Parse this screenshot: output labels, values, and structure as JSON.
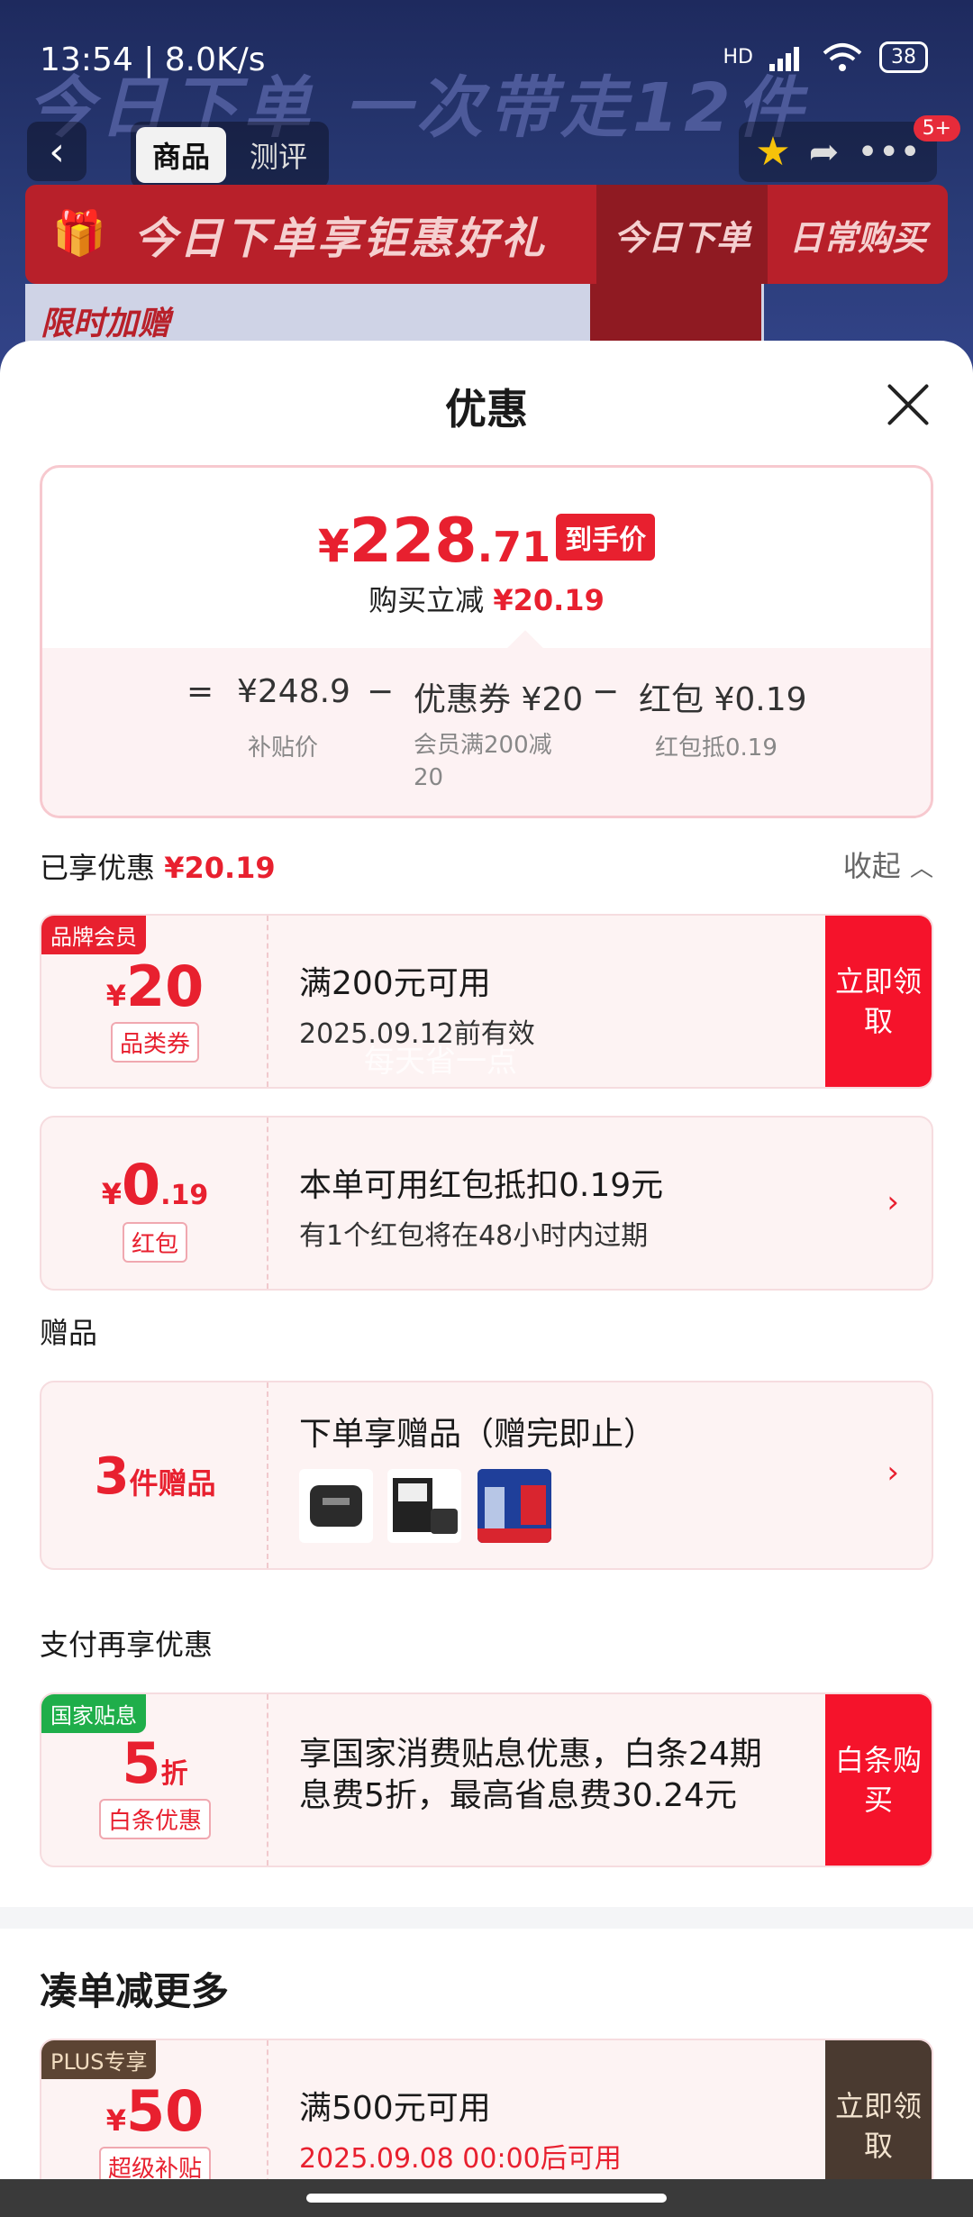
{
  "status": {
    "time": "13:54 | 8.0K/s",
    "battery": "38",
    "network": "HD"
  },
  "background": {
    "banner": "今日下单 一次带走12件",
    "tabs": [
      "商品",
      "测评"
    ],
    "badge": "5+",
    "promo_title": "今日下单享钜惠好礼",
    "promo_tab_today": "今日下单",
    "promo_tab_daily": "日常购买",
    "promo_sub": "限时加赠"
  },
  "sheet": {
    "title": "优惠",
    "price": {
      "currency": "¥",
      "integer": "228",
      "decimal": ".71",
      "tag": "到手价",
      "reduce_label": "购买立减",
      "reduce_value": "¥20.19",
      "eq": "=",
      "base": "¥248.9",
      "minus1": "−",
      "coupon_part": "优惠券 ¥20",
      "minus2": "−",
      "redpack_part": "红包 ¥0.19",
      "base_sub": "补贴价",
      "coupon_sub": "会员满200减20",
      "redpack_sub": "红包抵0.19"
    },
    "enjoyed": {
      "label": "已享优惠",
      "value": "¥20.19",
      "collapse": "收起"
    },
    "coupon1": {
      "badge": "品牌会员",
      "currency": "¥",
      "amount": "20",
      "type": "品类券",
      "line1": "满200元可用",
      "line2": "2025.09.12前有效",
      "action": "立即领取"
    },
    "watermark": "每天省一点",
    "coupon2": {
      "currency": "¥",
      "amount": "0",
      "decimal": ".19",
      "type": "红包",
      "line1": "本单可用红包抵扣0.19元",
      "line2": "有1个红包将在48小时内过期"
    },
    "gift_section": "赠品",
    "gift": {
      "count": "3",
      "unit": "件赠品",
      "title": "下单享赠品（赠完即止）"
    },
    "pay_section": "支付再享优惠",
    "coupon3": {
      "badge": "国家贴息",
      "amount": "5",
      "unit": "折",
      "type": "白条优惠",
      "line1": "享国家消费贴息优惠，白条24期",
      "line2": "息费5折，最高省息费30.24元",
      "action": "白条购买"
    },
    "more_section": "凑单减更多",
    "coupon4": {
      "badge": "PLUS专享",
      "currency": "¥",
      "amount": "50",
      "type": "超级补贴",
      "line1": "满500元可用",
      "line2": "2025.09.08 00:00后可用",
      "action": "立即领取"
    }
  }
}
